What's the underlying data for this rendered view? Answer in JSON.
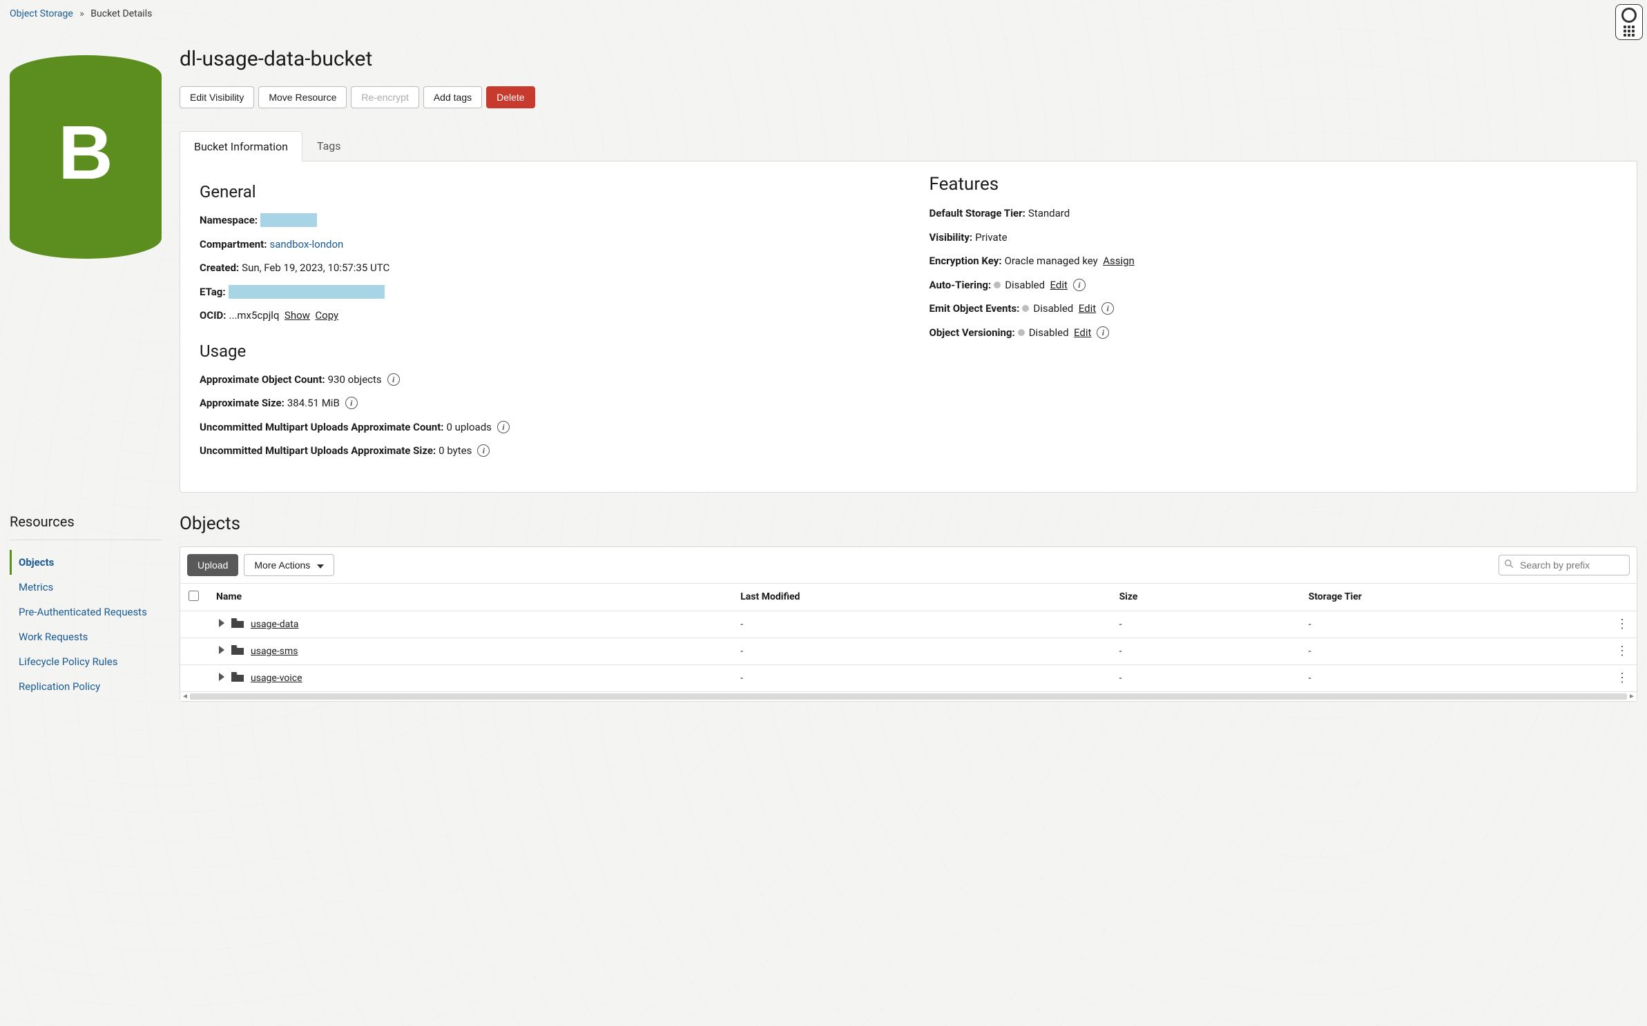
{
  "breadcrumb": {
    "root": "Object Storage",
    "current": "Bucket Details"
  },
  "title": "dl-usage-data-bucket",
  "actions": {
    "edit_visibility": "Edit Visibility",
    "move_resource": "Move Resource",
    "re_encrypt": "Re-encrypt",
    "add_tags": "Add tags",
    "delete": "Delete"
  },
  "tabs": {
    "info": "Bucket Information",
    "tags": "Tags"
  },
  "general": {
    "heading": "General",
    "namespace_label": "Namespace:",
    "compartment_label": "Compartment:",
    "compartment_value": "sandbox-london",
    "created_label": "Created:",
    "created_value": "Sun, Feb 19, 2023, 10:57:35 UTC",
    "etag_label": "ETag:",
    "ocid_label": "OCID:",
    "ocid_value": "...mx5cpjlq",
    "show": "Show",
    "copy": "Copy"
  },
  "usage": {
    "heading": "Usage",
    "obj_count_label": "Approximate Object Count:",
    "obj_count_value": "930 objects",
    "size_label": "Approximate Size:",
    "size_value": "384.51 MiB",
    "mpu_count_label": "Uncommitted Multipart Uploads Approximate Count:",
    "mpu_count_value": "0 uploads",
    "mpu_size_label": "Uncommitted Multipart Uploads Approximate Size:",
    "mpu_size_value": "0 bytes"
  },
  "features": {
    "heading": "Features",
    "storage_tier_label": "Default Storage Tier:",
    "storage_tier_value": "Standard",
    "visibility_label": "Visibility:",
    "visibility_value": "Private",
    "enc_label": "Encryption Key:",
    "enc_value": "Oracle managed key",
    "assign": "Assign",
    "auto_tier_label": "Auto-Tiering:",
    "auto_tier_value": "Disabled",
    "emit_label": "Emit Object Events:",
    "emit_value": "Disabled",
    "versioning_label": "Object Versioning:",
    "versioning_value": "Disabled",
    "edit": "Edit"
  },
  "resources": {
    "heading": "Resources",
    "items": [
      {
        "label": "Objects",
        "active": true
      },
      {
        "label": "Metrics",
        "active": false
      },
      {
        "label": "Pre-Authenticated Requests",
        "active": false
      },
      {
        "label": "Work Requests",
        "active": false
      },
      {
        "label": "Lifecycle Policy Rules",
        "active": false
      },
      {
        "label": "Replication Policy",
        "active": false
      }
    ]
  },
  "objects": {
    "heading": "Objects",
    "upload": "Upload",
    "more_actions": "More Actions",
    "search_placeholder": "Search by prefix",
    "columns": {
      "name": "Name",
      "last_modified": "Last Modified",
      "size": "Size",
      "storage_tier": "Storage Tier"
    },
    "rows": [
      {
        "name": "usage-data",
        "last_modified": "-",
        "size": "-",
        "storage_tier": "-"
      },
      {
        "name": "usage-sms",
        "last_modified": "-",
        "size": "-",
        "storage_tier": "-"
      },
      {
        "name": "usage-voice",
        "last_modified": "-",
        "size": "-",
        "storage_tier": "-"
      }
    ]
  }
}
